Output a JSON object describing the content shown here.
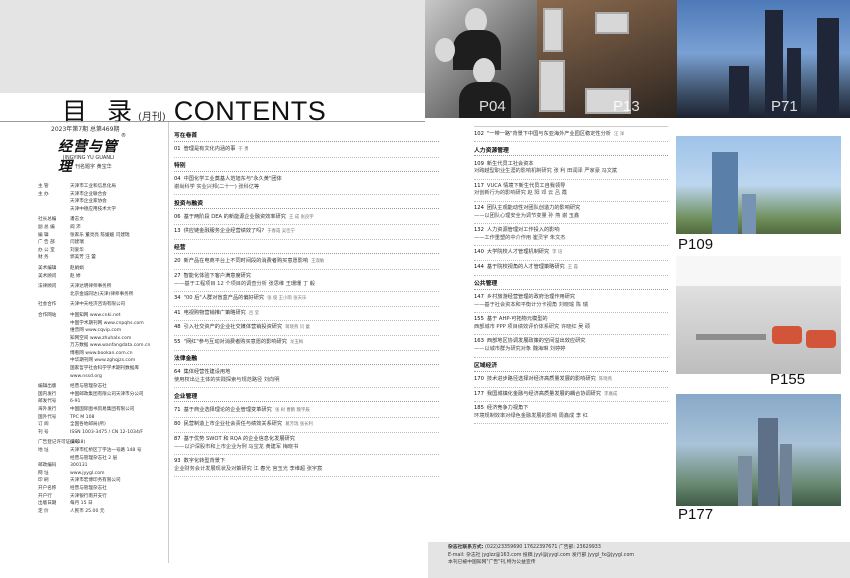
{
  "header": {
    "title_cn": "目 录",
    "title_paren": "(月刊)",
    "title_en": "CONTENTS",
    "photo_labels": [
      "P04",
      "P13",
      "P71"
    ]
  },
  "left": {
    "issue": "2023年第7期  总第469期",
    "logo_text": "经营与管理",
    "logo_mark": "®",
    "pinyin": "JINGYING YU GUANLI",
    "inscription": "刊名题字   黄宝华",
    "masthead": [
      {
        "k": "主      管",
        "v": "天津市工业和信息化局"
      },
      {
        "k": "主      办",
        "v": "天津市企业联合会"
      },
      {
        "k": "",
        "v": "天津市企业家协会"
      },
      {
        "k": "",
        "v": "天津中德应用技术大学"
      },
      {
        "k": "",
        "v": ""
      },
      {
        "k": "社长总编",
        "v": "潘志文"
      },
      {
        "k": "副 总 编",
        "v": "阎 沛"
      },
      {
        "k": "编      辑",
        "v": "张家乐  董亮亮  陈媛媛  闫建瑞"
      },
      {
        "k": "广 告 部",
        "v": "闫建瑞"
      },
      {
        "k": "办 公 室",
        "v": "刘爱华"
      },
      {
        "k": "财      务",
        "v": "郭美芳  汪 蕾"
      },
      {
        "k": "",
        "v": ""
      },
      {
        "k": "美术编辑",
        "v": "赵娟娟"
      },
      {
        "k": "美术顾问",
        "v": "赵 婷"
      },
      {
        "k": "",
        "v": ""
      },
      {
        "k": "法律顾问",
        "v": "天津达明律师事务所"
      },
      {
        "k": "",
        "v": "北京金诚同达(天津)律师事务所"
      },
      {
        "k": "",
        "v": ""
      },
      {
        "k": "社会合作",
        "v": "天津中天经济咨询有限公司"
      },
      {
        "k": "",
        "v": ""
      },
      {
        "k": "合作网站",
        "v": "中国知网 www.cnki.net"
      },
      {
        "k": "",
        "v": "中国学术期刊网 www.cnpqhs.com"
      },
      {
        "k": "",
        "v": "维普网 www.cqvip.com"
      },
      {
        "k": "",
        "v": "知网空间 www.zhuhalx.com"
      },
      {
        "k": "",
        "v": "万方数据 www.wanfangdata.com.cn"
      },
      {
        "k": "",
        "v": "博看网 www.bookan.com.cn"
      },
      {
        "k": "",
        "v": "中华期刊网 www.zghqjzs.com"
      },
      {
        "k": "",
        "v": "国家哲学社会科学学术期刊数据库"
      },
      {
        "k": "",
        "v": "www.nssd.org"
      },
      {
        "k": "",
        "v": ""
      },
      {
        "k": "编辑出版",
        "v": "经营与管理杂志社"
      },
      {
        "k": "国内发行",
        "v": "中国邮政集团有限公司天津市分公司"
      },
      {
        "k": "邮发代号",
        "v": "6-91"
      },
      {
        "k": "海外发行",
        "v": "中国国际图书贸易集团有限公司"
      },
      {
        "k": "国外代号",
        "v": "TPC   M   108"
      },
      {
        "k": "订      阅",
        "v": "全国各地邮局(所)"
      },
      {
        "k": "刊      号",
        "v": "ISSN 1003-3475 / CN 12-1034/F"
      },
      {
        "k": "",
        "v": ""
      },
      {
        "k": "广告登记许可证编号",
        "v": "(2018)"
      },
      {
        "k": "地      址",
        "v": "天津市红桥区丁字沽一号路 148 号"
      },
      {
        "k": "",
        "v": "经营与管理杂志社 2 层"
      },
      {
        "k": "邮政编码",
        "v": "300131"
      },
      {
        "k": "网      址",
        "v": "www.jyygl.com"
      },
      {
        "k": "印      刷",
        "v": "天津市宏博印务有限公司"
      },
      {
        "k": "开户名称",
        "v": "经营与管理杂志社"
      },
      {
        "k": "开户行",
        "v": "天津银行南开支行"
      },
      {
        "k": "出版日期",
        "v": "每月 15 日"
      },
      {
        "k": "定      价",
        "v": "人民币 25.00 元"
      }
    ]
  },
  "contents_left": [
    {
      "section": "写在卷首",
      "entries": [
        {
          "page": "01",
          "title": "管理是有文化内涵的事",
          "author": "于 勇",
          "sub": ""
        }
      ]
    },
    {
      "section": "特别",
      "entries": [
        {
          "page": "04",
          "title": "中国化学工业奠基人范旭东与\"永久黄\"团体",
          "author": "",
          "sub": "谢尚科学 实业兴邦(二十一)  张科亿等"
        }
      ]
    },
    {
      "section": "投资与融资",
      "entries": [
        {
          "page": "06",
          "title": "基于两阶段 DEA 的新能源企业融资效率研究",
          "author": "王 成  张良宇",
          "sub": ""
        },
        {
          "page": "13",
          "title": "供应链金融服务企业经营绩效了吗?",
          "author": "于春霞  吴佳宁",
          "sub": ""
        }
      ]
    },
    {
      "section": "经营",
      "entries": [
        {
          "page": "20",
          "title": "新产品在电商平台上不同时间段的消费者购买意愿影响",
          "author": "王淑敏",
          "sub": ""
        },
        {
          "page": "27",
          "title": "智能化体验下客户满意度研究",
          "author": "",
          "sub": "——基于工程项目 12 个项目的调查分析  张思维  王珊珊  丁 毅"
        },
        {
          "page": "34",
          "title": "\"00 后\"人群对盲盒产品的偏好研究",
          "author": "张 俊  王小雨  张天乐",
          "sub": ""
        },
        {
          "page": "41",
          "title": "电视购物营销推广策略研究",
          "author": "吕 莹",
          "sub": ""
        },
        {
          "page": "48",
          "title": "引入社交资产的企业社交媒体营销投资研究",
          "author": "蒋晓燕  闫 蕾",
          "sub": ""
        },
        {
          "page": "55",
          "title": "\"网红\"参与互动对消费者购买意愿的影响研究",
          "author": "龙玉梅",
          "sub": ""
        }
      ]
    },
    {
      "section": "法律金融",
      "entries": [
        {
          "page": "64",
          "title": "集体经营性建设用地",
          "author": "",
          "sub": "使用权出让主体的实践探索与规范路径  刘向明"
        }
      ]
    },
    {
      "section": "企业管理",
      "entries": [
        {
          "page": "71",
          "title": "基于商业选择理论的企业管理变革研究",
          "author": "张 树  曹鹏  魏宇辰",
          "sub": ""
        },
        {
          "page": "80",
          "title": "民营制造上市企业社会责任与绩效关系研究",
          "author": "葛芳瑞  张长利",
          "sub": ""
        },
        {
          "page": "87",
          "title": "基于优势 SWOT 和 RQA 的企业信息化发展研究",
          "author": "",
          "sub": "——以沪深股市和上市企业为例  马宝龙  黄建军  梅晓书"
        },
        {
          "page": "93",
          "title": "数字化转型背景下",
          "author": "",
          "sub": "企业财务会计发展现状及对策研究  江 春光  宫玉光  李维超  张宇宸"
        }
      ]
    }
  ],
  "contents_right": [
    {
      "section": "",
      "entries": [
        {
          "page": "102",
          "title": "\"一带一路\"背景下中国与东亚海外产业园区稳定性分析",
          "author": "汪 洋",
          "sub": ""
        }
      ]
    },
    {
      "section": "人力资源管理",
      "entries": [
        {
          "page": "109",
          "title": "新生代员工社会资本",
          "author": "",
          "sub": "对跨越型职业生涯的影响机制研究  张 利  田润泽  严家豪  冯文斌"
        },
        {
          "page": "117",
          "title": "VUCA 情境下新生代员工自我领导",
          "author": "",
          "sub": "对创新行为的影响研究  赵 阳  邓 云  吕 霞"
        },
        {
          "page": "124",
          "title": "团队主观能动性对团队创造力的影响研究",
          "author": "",
          "sub": "——以团队心理安全为调节变量  孙 燕  谢 玉鑫"
        },
        {
          "page": "132",
          "title": "人力资源管理对工作投入的影响",
          "author": "",
          "sub": "——工作重塑的中介作用  崔灵宇  朱文杰"
        },
        {
          "page": "140",
          "title": "大学院校人才管理机制研究",
          "author": "李 培",
          "sub": ""
        },
        {
          "page": "144",
          "title": "基于院校视角的人才管理策略研究",
          "author": "王 霞",
          "sub": ""
        }
      ]
    },
    {
      "section": "公共管理",
      "entries": [
        {
          "page": "147",
          "title": "乡村旅游经营管理的政府治理作用研究",
          "author": "",
          "sub": "——基于社会资本和平衡计分卡视角  刘晓瑜  陈 瑞"
        },
        {
          "page": "155",
          "title": "基于 AHP-可拓物元模型的",
          "author": "",
          "sub": "西部城市 PPP 项目绩效评价体系研究  许晓红  吴 硕"
        },
        {
          "page": "163",
          "title": "西部地区协调发展政策的空间溢出效应研究",
          "author": "",
          "sub": "——以城市群为研究对象  魏海琳  刘婷婷"
        }
      ]
    },
    {
      "section": "区域经济",
      "entries": [
        {
          "page": "170",
          "title": "技术进步路径选择对经济高质量发展的影响研究",
          "author": "陈晓燕",
          "sub": ""
        },
        {
          "page": "177",
          "title": "我国城镇化金融与经济高质量发展的耦合协调研究",
          "author": "李嘉成",
          "sub": ""
        },
        {
          "page": "185",
          "title": "经济竞争力视角下",
          "author": "",
          "sub": "环境规制效率对绿色金融发展的影响  周鑫成  李 红"
        }
      ]
    }
  ],
  "right_photos": [
    "P109",
    "P155",
    "P177"
  ],
  "footer": {
    "line1_label": "杂志社联系方式:",
    "line1": "(022)23359690  17622397671  广告部: 23629933",
    "line2": "E-mail: 杂志社 jyglzz@163.com   投稿 jyyl@jyygl.com   发行部 jyygl_fx@jyygl.com",
    "line3": "本刊已被中国知网\"广告\"刊,特为公益宣传"
  }
}
